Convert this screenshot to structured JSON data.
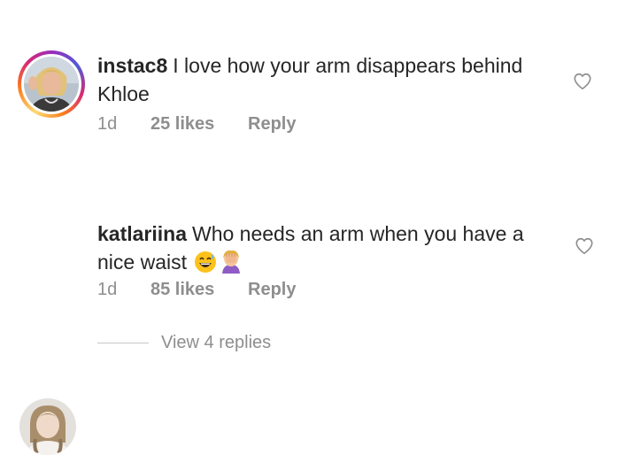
{
  "comments": [
    {
      "username": "instac8",
      "text": "I love how your arm disappears behind Khloe",
      "time": "1d",
      "likes": "25 likes",
      "reply_label": "Reply",
      "avatar_ring": true,
      "heart_icon": "heart-outline-icon"
    },
    {
      "username": "katlariina",
      "text": "Who needs an arm when you have a nice waist",
      "emojis": [
        "grinning-sweat-emoji",
        "facepalm-emoji"
      ],
      "time": "1d",
      "likes": "85 likes",
      "reply_label": "Reply",
      "avatar_ring": false,
      "heart_icon": "heart-outline-icon"
    }
  ],
  "view_replies": {
    "label": "View 4 replies"
  },
  "colors": {
    "text": "#262626",
    "meta": "#8e8e8e",
    "divider": "#c7c7c7"
  }
}
